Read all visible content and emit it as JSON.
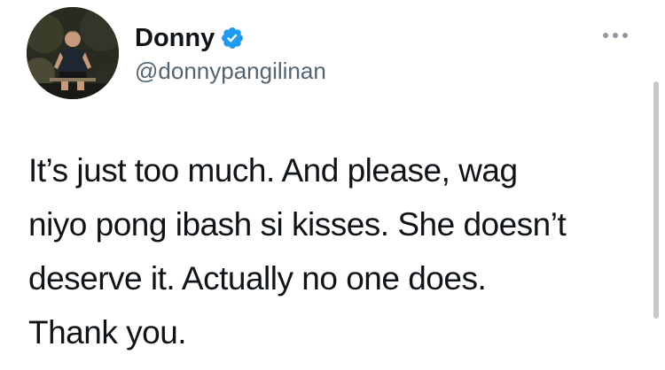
{
  "author": {
    "display_name": "Donny",
    "handle": "@donnypangilinan",
    "verified": true,
    "avatar_icon": "profile-photo"
  },
  "tweet": {
    "lines": [
      "It’s just too much. And please, wag",
      "niyo pong ibash si kisses. She doesn’t",
      "deserve it. Actually no one does.",
      "Thank you."
    ]
  },
  "icons": {
    "verified": "verified-badge-icon",
    "more": "more-options-icon"
  },
  "colors": {
    "verified_blue": "#1d9bf0",
    "text": "#0f1419",
    "secondary_text": "#536471",
    "background": "#ffffff"
  }
}
